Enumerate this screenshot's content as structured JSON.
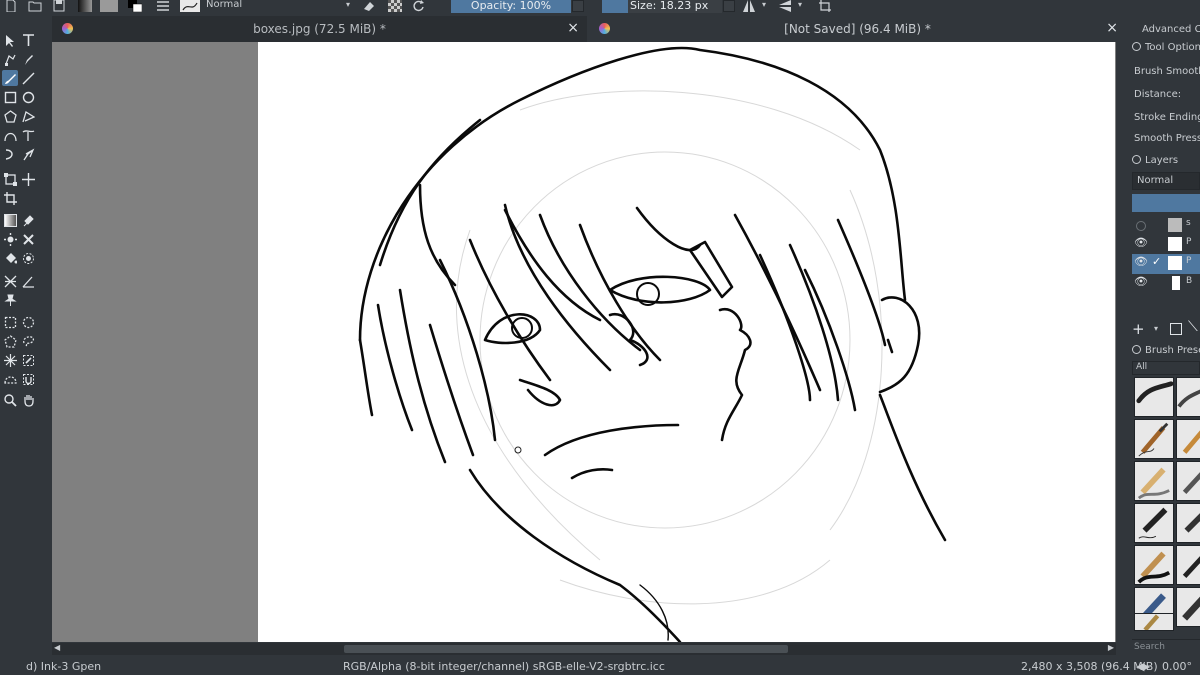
{
  "toolbar": {
    "blend_mode": "Normal",
    "opacity_label": "Opacity: 100%",
    "size_label": "Size: 18.23 px"
  },
  "tabs": [
    {
      "title": "boxes.jpg (72.5 MiB) *",
      "close": "×"
    },
    {
      "title": "[Not Saved]  (96.4 MiB) *",
      "close": "×"
    }
  ],
  "status": {
    "brush": "d) Ink-3 Gpen",
    "color_profile": "RGB/Alpha (8-bit integer/channel)  sRGB-elle-V2-srgbtrc.icc",
    "dimensions": "2,480 x 3,508 (96.4 MiB)",
    "rotation": "0.00°"
  },
  "docker": {
    "advanced_color": "Advanced Co",
    "tool_options": "Tool Options",
    "brush_smoothing": "Brush Smoothi",
    "distance": "Distance:",
    "stroke_ending": "Stroke Ending:",
    "smooth_pressure": "Smooth Pressu",
    "layers_title": "Layers",
    "layers_blend": "Normal",
    "brush_presets_title": "Brush Prese",
    "presets_filter": "All",
    "search_placeholder": "Search"
  },
  "layers": [
    {
      "visible": false,
      "label": "s"
    },
    {
      "visible": true,
      "label": "P"
    },
    {
      "visible": true,
      "label": "P",
      "active": true
    },
    {
      "visible": true,
      "label": "B"
    }
  ],
  "colors": {
    "accent": "#4f78a0",
    "panel": "#31363b",
    "canvas_bg": "#808080",
    "paper": "#ffffff"
  }
}
